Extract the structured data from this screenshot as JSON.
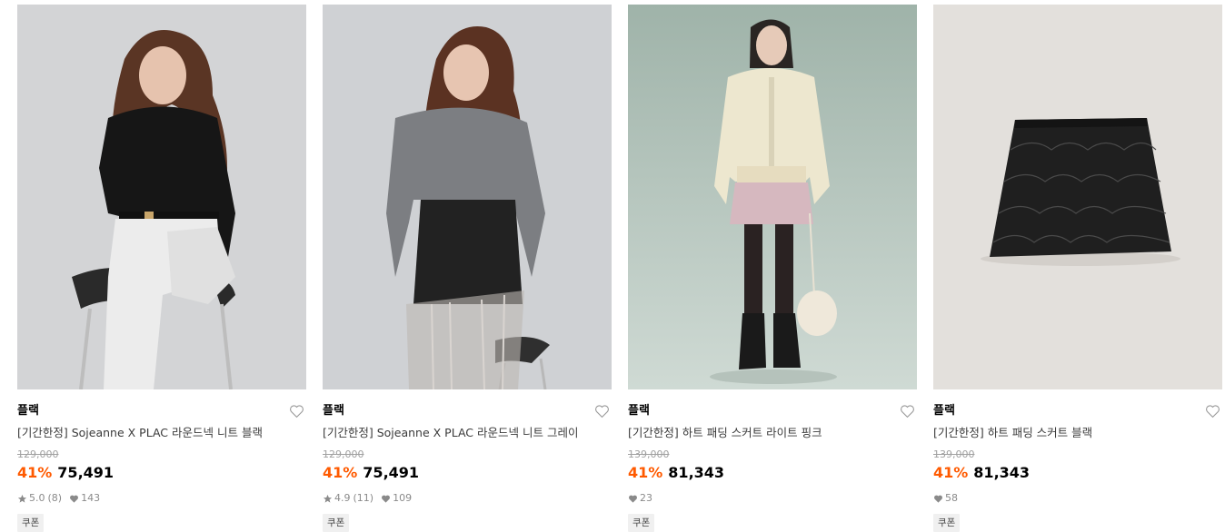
{
  "products": [
    {
      "brand": "플랙",
      "title": "[기간한정] Sojeanne X PLAC 라운드넥 니트 블랙",
      "original_price": "129,000",
      "discount": "41%",
      "price": "75,491",
      "rating": "5.0",
      "reviews": "(8)",
      "likes": "143",
      "coupon": "쿠폰",
      "like_icon": "heart-outline-icon",
      "image": "model-black-knit"
    },
    {
      "brand": "플랙",
      "title": "[기간한정] Sojeanne X PLAC 라운드넥 니트 그레이",
      "original_price": "129,000",
      "discount": "41%",
      "price": "75,491",
      "rating": "4.9",
      "reviews": "(11)",
      "likes": "109",
      "coupon": "쿠폰",
      "like_icon": "heart-outline-icon",
      "image": "model-gray-knit"
    },
    {
      "brand": "플랙",
      "title": "[기간한정] 하트 패딩 스커트 라이트 핑크",
      "original_price": "139,000",
      "discount": "41%",
      "price": "81,343",
      "likes": "23",
      "coupon": "쿠폰",
      "like_icon": "heart-outline-icon",
      "image": "model-pink-skirt"
    },
    {
      "brand": "플랙",
      "title": "[기간한정] 하트 패딩 스커트 블랙",
      "original_price": "139,000",
      "discount": "41%",
      "price": "81,343",
      "likes": "58",
      "coupon": "쿠폰",
      "like_icon": "heart-outline-icon",
      "image": "black-quilted-skirt"
    }
  ],
  "colors": {
    "discount": "#ff5a00",
    "text": "#000000",
    "muted": "#8a8a8a"
  }
}
